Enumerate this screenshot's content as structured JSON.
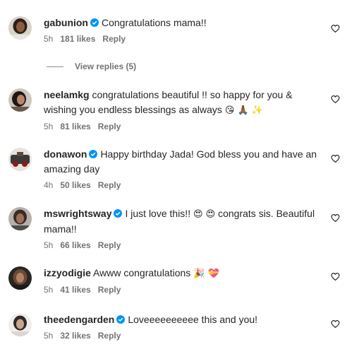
{
  "comments": [
    {
      "username": "gabunion",
      "verified": true,
      "text": "Congratulations mama!!",
      "time": "5h",
      "likes": "181 likes",
      "reply": "Reply"
    },
    {
      "username": "neelamkg",
      "verified": false,
      "text": "congratulations beautiful !! so happy for you & wishing you endless blessings as always",
      "emoji": "😘 🙏🏾 ✨",
      "time": "5h",
      "likes": "81 likes",
      "reply": "Reply"
    },
    {
      "username": "donawon",
      "verified": true,
      "text": "Happy birthday Jada! God bless you and have an amazing day",
      "time": "4h",
      "likes": "50 likes",
      "reply": "Reply"
    },
    {
      "username": "mswrightsway",
      "verified": true,
      "text": "I just love this!!",
      "emoji": "😍 😍",
      "text_after": "congrats sis. Beautiful mama!!",
      "time": "5h",
      "likes": "66 likes",
      "reply": "Reply"
    },
    {
      "username": "izzyodigie",
      "verified": false,
      "text": "Awww congratulations",
      "emoji": "🎉 💝",
      "time": "5h",
      "likes": "41 likes",
      "reply": "Reply"
    },
    {
      "username": "theedengarden",
      "verified": true,
      "text": "Loveeeeeeeeee this and you!",
      "time": "5h",
      "likes": "32 likes",
      "reply": "Reply"
    }
  ],
  "view_replies": "View replies (5)",
  "icons": {
    "verified": "verified-badge-icon",
    "like": "heart-outline-icon"
  },
  "colors": {
    "verified_blue": "#0095f6",
    "meta_gray": "#737373",
    "text": "#262626"
  }
}
